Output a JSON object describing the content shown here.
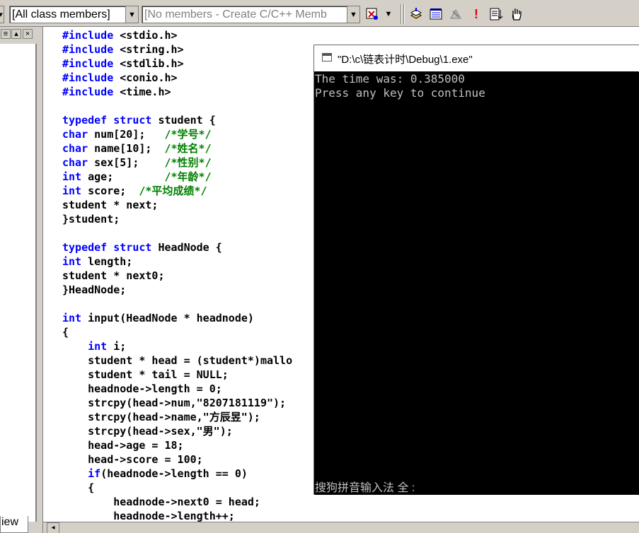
{
  "toolbar": {
    "class_combo": "[All class members]",
    "member_combo": "[No members - Create C/C++ Memb"
  },
  "leftpane": {
    "tab_label": "iew"
  },
  "editor": {
    "lines": [
      [
        {
          "t": "#include",
          "c": "kw"
        },
        {
          "t": " <stdio.h>"
        }
      ],
      [
        {
          "t": "#include",
          "c": "kw"
        },
        {
          "t": " <string.h>"
        }
      ],
      [
        {
          "t": "#include",
          "c": "kw"
        },
        {
          "t": " <stdlib.h>"
        }
      ],
      [
        {
          "t": "#include",
          "c": "kw"
        },
        {
          "t": " <conio.h>"
        }
      ],
      [
        {
          "t": "#include",
          "c": "kw"
        },
        {
          "t": " <time.h>"
        }
      ],
      [],
      [
        {
          "t": "typedef",
          "c": "kw"
        },
        {
          "t": " "
        },
        {
          "t": "struct",
          "c": "kw"
        },
        {
          "t": " student {"
        }
      ],
      [
        {
          "t": "char",
          "c": "kw"
        },
        {
          "t": " num[20];   "
        },
        {
          "t": "/*学号*/",
          "c": "cm"
        }
      ],
      [
        {
          "t": "char",
          "c": "kw"
        },
        {
          "t": " name[10];  "
        },
        {
          "t": "/*姓名*/",
          "c": "cm"
        }
      ],
      [
        {
          "t": "char",
          "c": "kw"
        },
        {
          "t": " sex[5];    "
        },
        {
          "t": "/*性别*/",
          "c": "cm"
        }
      ],
      [
        {
          "t": "int",
          "c": "kw"
        },
        {
          "t": " age;        "
        },
        {
          "t": "/*年龄*/",
          "c": "cm"
        }
      ],
      [
        {
          "t": "int",
          "c": "kw"
        },
        {
          "t": " score;  "
        },
        {
          "t": "/*平均成绩*/",
          "c": "cm"
        }
      ],
      [
        {
          "t": "student * next;"
        }
      ],
      [
        {
          "t": "}student;"
        }
      ],
      [],
      [
        {
          "t": "typedef",
          "c": "kw"
        },
        {
          "t": " "
        },
        {
          "t": "struct",
          "c": "kw"
        },
        {
          "t": " HeadNode {"
        }
      ],
      [
        {
          "t": "int",
          "c": "kw"
        },
        {
          "t": " length;"
        }
      ],
      [
        {
          "t": "student * next0;"
        }
      ],
      [
        {
          "t": "}HeadNode;"
        }
      ],
      [],
      [
        {
          "t": "int",
          "c": "kw"
        },
        {
          "t": " input(HeadNode * headnode)"
        }
      ],
      [
        {
          "t": "{"
        }
      ],
      [
        {
          "t": "    "
        },
        {
          "t": "int",
          "c": "kw"
        },
        {
          "t": " i;"
        }
      ],
      [
        {
          "t": "    student * head = (student*)mallo"
        }
      ],
      [
        {
          "t": "    student * tail = NULL;"
        }
      ],
      [
        {
          "t": "    headnode->length = 0;"
        }
      ],
      [
        {
          "t": "    strcpy(head->num,\"8207181119\");"
        }
      ],
      [
        {
          "t": "    strcpy(head->name,\"方辰昱\");"
        }
      ],
      [
        {
          "t": "    strcpy(head->sex,\"男\");"
        }
      ],
      [
        {
          "t": "    head->age = 18;"
        }
      ],
      [
        {
          "t": "    head->score = 100;"
        }
      ],
      [
        {
          "t": "    "
        },
        {
          "t": "if",
          "c": "kw"
        },
        {
          "t": "(headnode->length == 0)"
        }
      ],
      [
        {
          "t": "    {"
        }
      ],
      [
        {
          "t": "        headnode->next0 = head;"
        }
      ],
      [
        {
          "t": "        headnode->length++;"
        }
      ]
    ]
  },
  "console": {
    "title": "\"D:\\c\\链表计时\\Debug\\1.exe\"",
    "output": [
      "The time was: 0.385000",
      "Press any key to continue"
    ],
    "ime_status": "搜狗拼音输入法 全 :"
  }
}
